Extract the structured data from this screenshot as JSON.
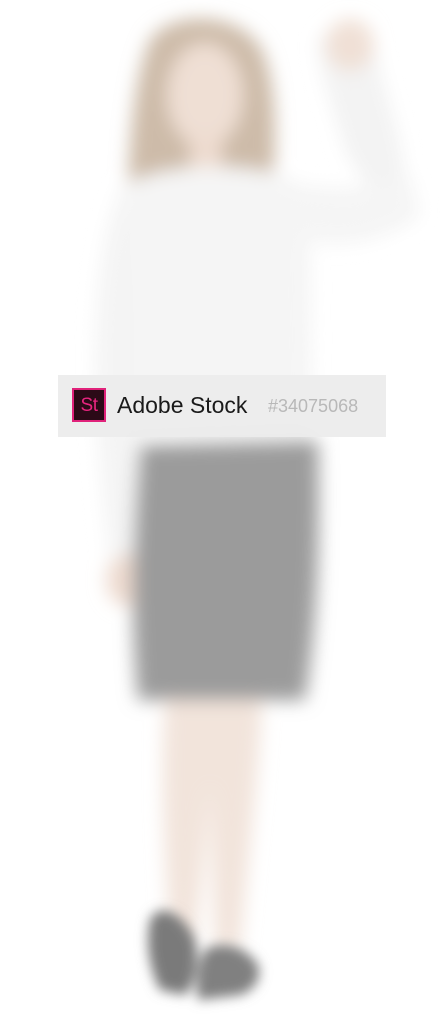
{
  "image": {
    "description_hidden": "",
    "colors": {
      "background": "#ffffff",
      "blouse": "#f4f4f4",
      "skirt": "#9c9c9c",
      "skin": "#f1e2d8",
      "hair": "#c9b6a6",
      "shoes": "#7f7f7f"
    }
  },
  "watermark": {
    "logo_text": "St",
    "brand": "Adobe Stock",
    "asset_id": "#34075068",
    "logo_colors": {
      "fill": "#2b0a17",
      "accent": "#e0227a"
    }
  }
}
